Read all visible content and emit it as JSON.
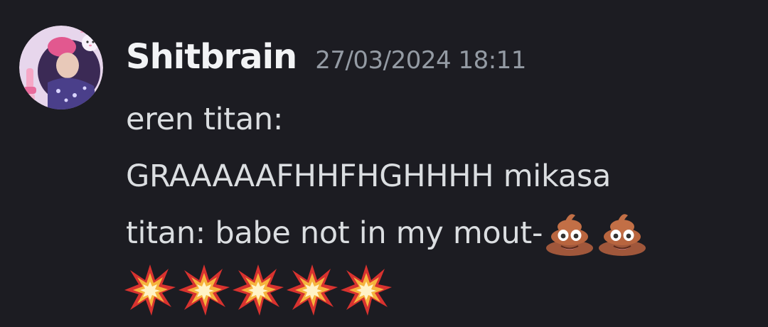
{
  "message": {
    "author": "Shitbrain",
    "timestamp": "27/03/2024 18:11",
    "lines": [
      "eren titan:",
      "GRAAAAAFHHFHGHHHH mikasa",
      "titan: babe not in my mout-"
    ],
    "inline_emojis": [
      "pile-of-poo-icon",
      "pile-of-poo-icon"
    ],
    "trailing_emojis": [
      "collision-icon",
      "collision-icon",
      "collision-icon",
      "collision-icon",
      "collision-icon"
    ]
  },
  "colors": {
    "background": "#1c1c22",
    "username": "#f2f3f5",
    "timestamp": "#949ba4",
    "text": "#dbdee1"
  }
}
